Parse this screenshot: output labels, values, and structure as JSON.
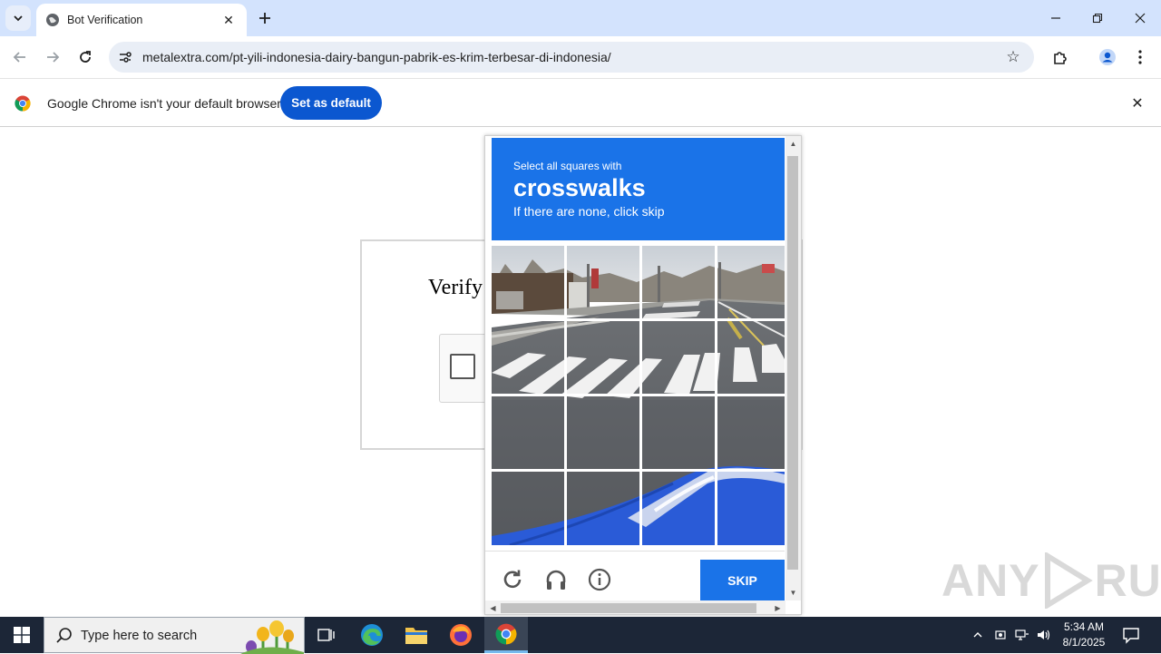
{
  "browser": {
    "tab": {
      "title": "Bot Verification"
    },
    "url": "metalextra.com/pt-yili-indonesia-dairy-bangun-pabrik-es-krim-terbesar-di-indonesia/",
    "icons": {
      "tab_search": "chevron-down-icon",
      "back": "arrow-left-icon",
      "forward": "arrow-right-icon",
      "reload": "reload-icon",
      "site_info": "tune-icon",
      "bookmark": "star-icon",
      "extensions": "puzzle-icon",
      "profile": "person-icon",
      "menu": "kebab-icon"
    }
  },
  "infobar": {
    "message": "Google Chrome isn't your default browser",
    "button": "Set as default"
  },
  "page": {
    "heading": "Verify"
  },
  "challenge": {
    "line1": "Select all squares with",
    "target": "crosswalks",
    "line2": "If there are none, click skip",
    "skip_label": "SKIP",
    "grid": {
      "rows": 4,
      "cols": 4
    },
    "header_color": "#1a73e8"
  },
  "watermark": "ANY RUN",
  "taskbar": {
    "search_placeholder": "Type here to search",
    "time": "5:34 AM",
    "date": "8/1/2025"
  }
}
